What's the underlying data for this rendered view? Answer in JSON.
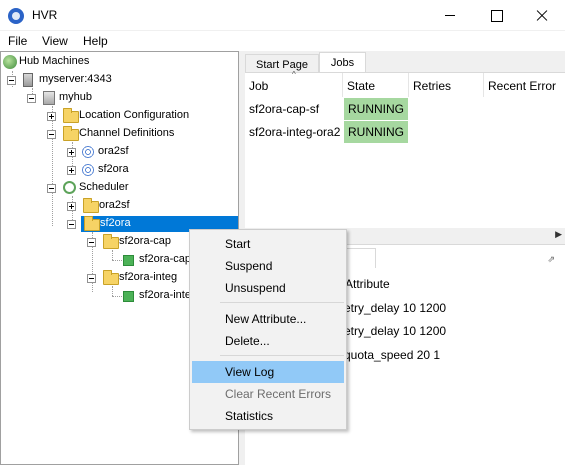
{
  "window": {
    "title": "HVR"
  },
  "menubar": {
    "items": [
      "File",
      "View",
      "Help"
    ]
  },
  "tree": {
    "root": "Hub Machines",
    "server": "myserver:4343",
    "hub": "myhub",
    "location_config": "Location Configuration",
    "channel_defs": "Channel Definitions",
    "channel_1": "ora2sf",
    "channel_2": "sf2ora",
    "scheduler": "Scheduler",
    "sched_1": "ora2sf",
    "sched_2": "sf2ora",
    "sub_cap": "sf2ora-cap",
    "sub_cap_job": "sf2ora-cap",
    "sub_integ": "sf2ora-integ",
    "sub_integ_job": "sf2ora-integ"
  },
  "tabs": {
    "start_page": "Start Page",
    "jobs": "Jobs"
  },
  "jobs_table": {
    "headers": {
      "job": "Job",
      "state": "State",
      "retries": "Retries",
      "recent_error": "Recent Error"
    },
    "rows": [
      {
        "job": "sf2ora-cap-sf",
        "state": "RUNNING"
      },
      {
        "job": "sf2ora-integ-ora2",
        "state": "RUNNING"
      }
    ]
  },
  "attributes_panel": {
    "tab_label": "ites",
    "header": "Attribute",
    "rows": [
      "etry_delay 10 1200",
      "etry_delay 10 1200",
      "quota_speed 20 1"
    ]
  },
  "context_menu": {
    "start": "Start",
    "suspend": "Suspend",
    "unsuspend": "Unsuspend",
    "new_attribute": "New Attribute...",
    "delete": "Delete...",
    "view_log": "View Log",
    "clear_recent_errors": "Clear Recent Errors",
    "statistics": "Statistics"
  },
  "colors": {
    "selection": "#0078d7",
    "running": "#a6d8a0",
    "menu_highlight": "#91c9f7"
  },
  "icons": [
    "hvr-app-icon",
    "globe-icon",
    "server-icon",
    "hub-icon",
    "folder-icon",
    "scheduler-icon",
    "channel-icon",
    "job-icon",
    "minimize-icon",
    "maximize-icon",
    "close-icon"
  ]
}
